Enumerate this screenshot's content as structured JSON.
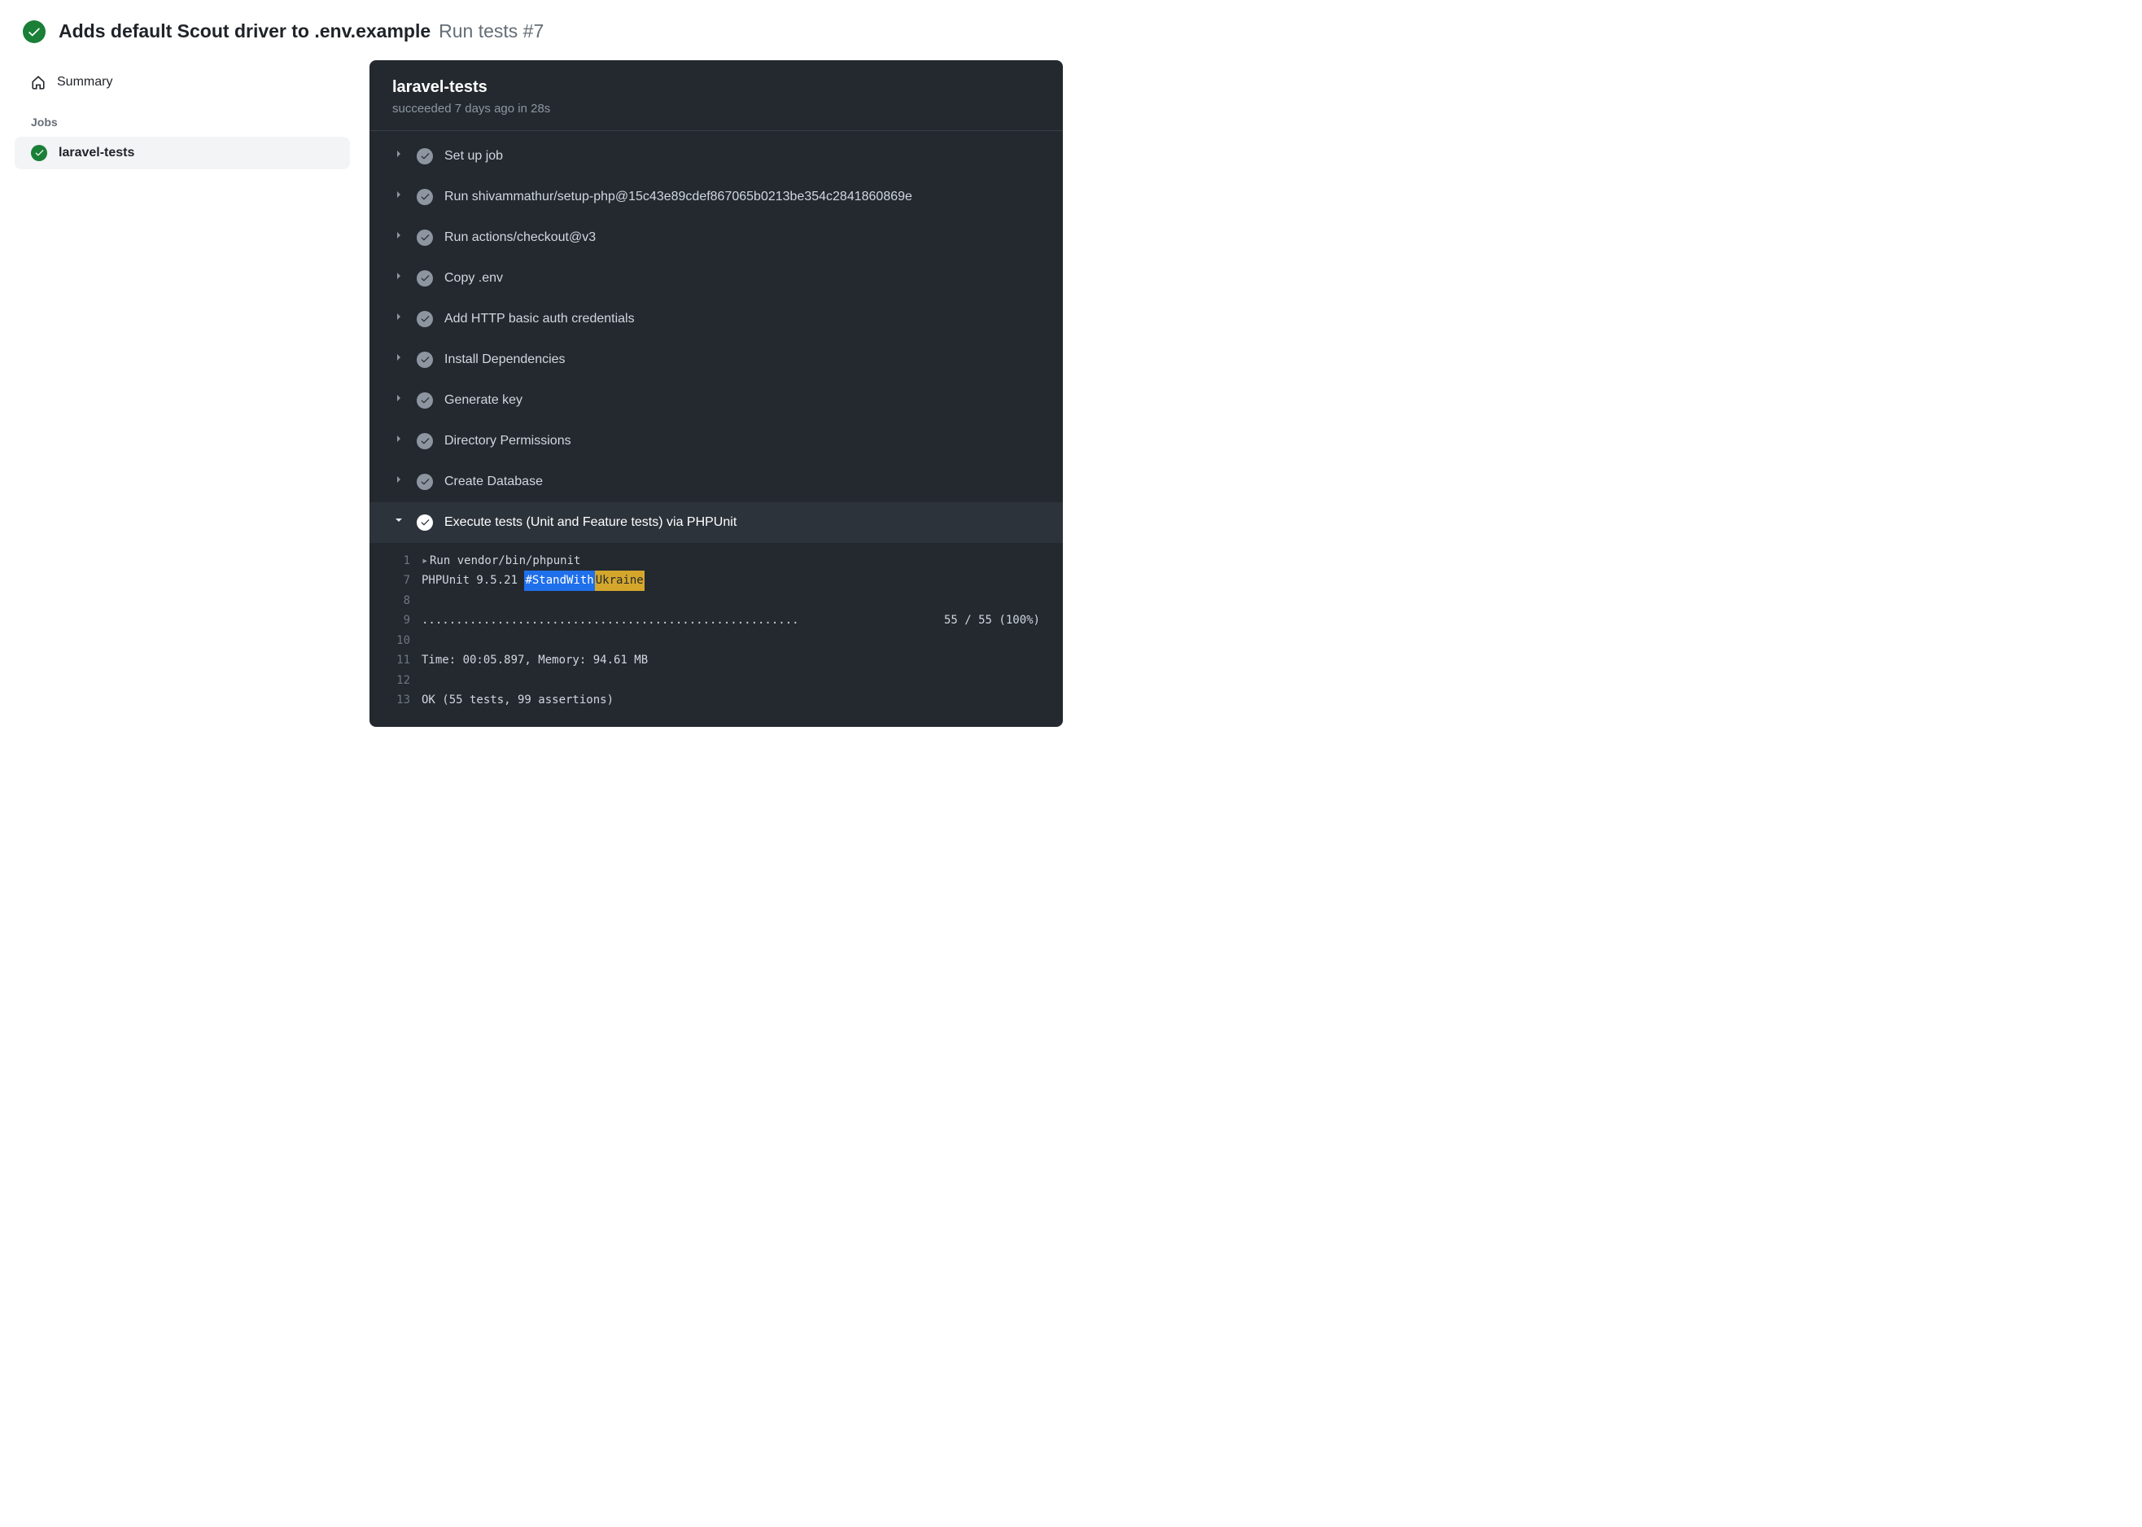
{
  "header": {
    "title": "Adds default Scout driver to .env.example",
    "subtitle": "Run tests #7"
  },
  "sidebar": {
    "summary": "Summary",
    "jobs_label": "Jobs",
    "jobs": [
      {
        "name": "laravel-tests"
      }
    ]
  },
  "panel": {
    "title": "laravel-tests",
    "meta": "succeeded 7 days ago in 28s"
  },
  "steps": [
    {
      "label": "Set up job",
      "expanded": false
    },
    {
      "label": "Run shivammathur/setup-php@15c43e89cdef867065b0213be354c2841860869e",
      "expanded": false
    },
    {
      "label": "Run actions/checkout@v3",
      "expanded": false
    },
    {
      "label": "Copy .env",
      "expanded": false
    },
    {
      "label": "Add HTTP basic auth credentials",
      "expanded": false
    },
    {
      "label": "Install Dependencies",
      "expanded": false
    },
    {
      "label": "Generate key",
      "expanded": false
    },
    {
      "label": "Directory Permissions",
      "expanded": false
    },
    {
      "label": "Create Database",
      "expanded": false
    },
    {
      "label": "Execute tests (Unit and Feature tests) via PHPUnit",
      "expanded": true
    }
  ],
  "log": {
    "lines": [
      {
        "num": "1",
        "caret": true,
        "text": "Run vendor/bin/phpunit"
      },
      {
        "num": "7",
        "phpunit_prefix": "PHPUnit 9.5.21 ",
        "tag_blue": "#StandWith",
        "tag_yellow": "Ukraine"
      },
      {
        "num": "8",
        "text": ""
      },
      {
        "num": "9",
        "dots": ".......................................................",
        "right": "55 / 55 (100%)"
      },
      {
        "num": "10",
        "text": ""
      },
      {
        "num": "11",
        "text": "Time: 00:05.897, Memory: 94.61 MB"
      },
      {
        "num": "12",
        "text": ""
      },
      {
        "num": "13",
        "text": "OK (55 tests, 99 assertions)"
      }
    ]
  }
}
